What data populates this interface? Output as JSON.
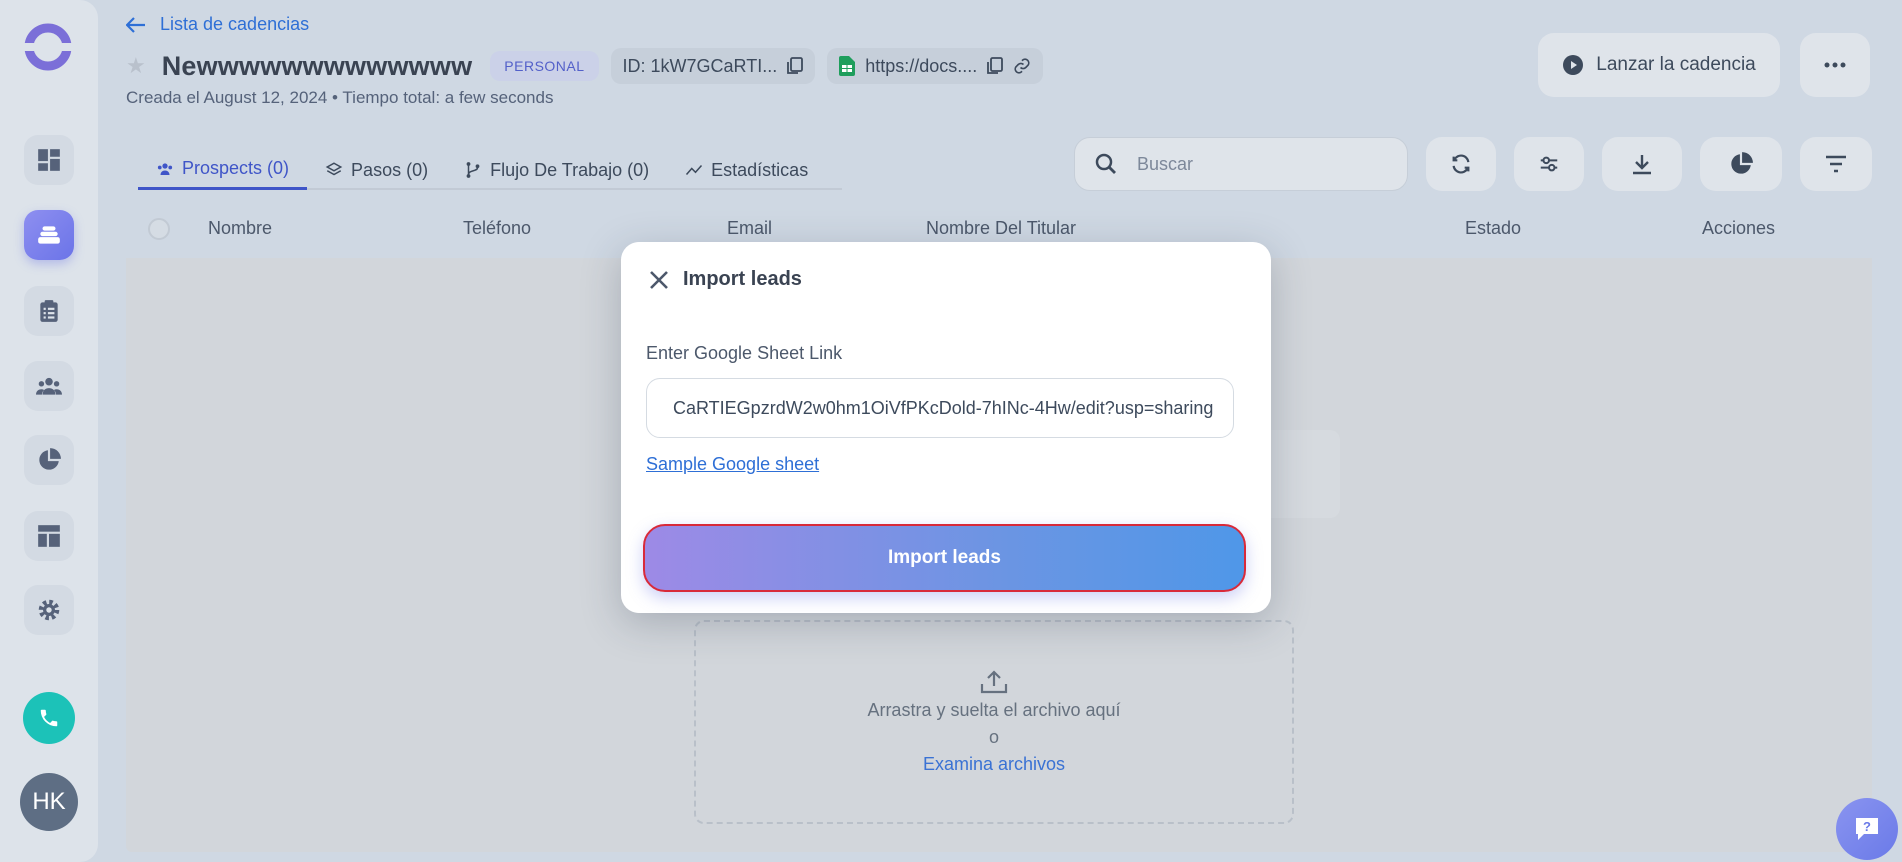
{
  "header": {
    "back_label": "Lista de cadencias",
    "title": "Newwwwwwwwwwwww",
    "tag": "PERSONAL",
    "id_label": "ID: 1kW7GCaRTI...",
    "doc_link": "https://docs....",
    "subtitle": "Creada el August 12, 2024 • Tiempo total: a few seconds",
    "launch_label": "Lanzar la cadencia"
  },
  "sidebar": {
    "avatar_initials": "HK"
  },
  "tabs": [
    {
      "label": "Prospects (0)"
    },
    {
      "label": "Pasos (0)"
    },
    {
      "label": "Flujo De Trabajo (0)"
    },
    {
      "label": "Estadísticas"
    }
  ],
  "search": {
    "placeholder": "Buscar"
  },
  "table": {
    "columns": [
      "Nombre",
      "Teléfono",
      "Email",
      "Nombre Del Titular",
      "Estado",
      "Acciones"
    ]
  },
  "dropzone": {
    "text": "Arrastra y suelta el archivo aquí",
    "or": "o",
    "browse": "Examina archivos"
  },
  "modal": {
    "title": "Import leads",
    "field_label": "Enter Google Sheet Link",
    "field_value": "CaRTIEGpzrdW2w0hm1OiVfPKcDold-7hINc-4Hw/edit?usp=sharing",
    "sample_link": "Sample Google sheet",
    "submit_label": "Import leads"
  },
  "colors": {
    "accent": "#3f55c8",
    "link": "#2e6fd6",
    "phone": "#1cc2b8",
    "button_gradient_start": "#9d8ae6",
    "button_gradient_end": "#4f97e8",
    "button_outline": "#d82a3a"
  }
}
